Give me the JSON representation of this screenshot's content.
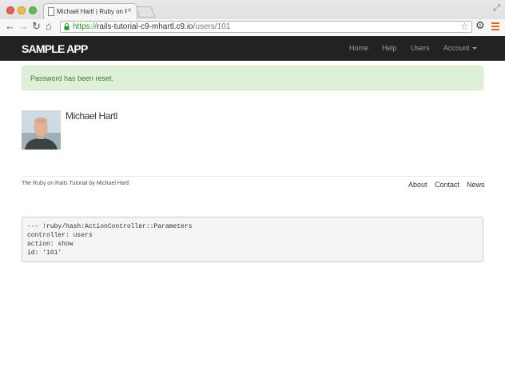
{
  "browser": {
    "tab_title": "Michael Hartl | Ruby on Rai",
    "tab_close": "×",
    "url_scheme": "https://",
    "url_host": "rails-tutorial-c9-mhartl.c9.io",
    "url_path": "/users/101",
    "icons": [
      "back-icon",
      "forward-icon",
      "reload-icon",
      "home-icon",
      "lock-icon",
      "star-icon",
      "gear-icon",
      "menu-icon"
    ]
  },
  "header": {
    "logo": "SAMPLE APP",
    "nav": {
      "home": "Home",
      "help": "Help",
      "users": "Users",
      "account": "Account"
    }
  },
  "flash": {
    "message": "Password has been reset.",
    "background_color": "#dff0d8",
    "text_color": "#3c763d"
  },
  "profile": {
    "name": "Michael Hartl"
  },
  "footer": {
    "prefix": "The ",
    "tutorial_link": "Ruby on Rails Tutorial",
    "by": " by ",
    "author_link": "Michael Hartl",
    "links": {
      "about": "About",
      "contact": "Contact",
      "news": "News"
    }
  },
  "debug": {
    "lines": [
      "--- !ruby/hash:ActionController::Parameters",
      "controller: users",
      "action: show",
      "id: '101'"
    ]
  }
}
